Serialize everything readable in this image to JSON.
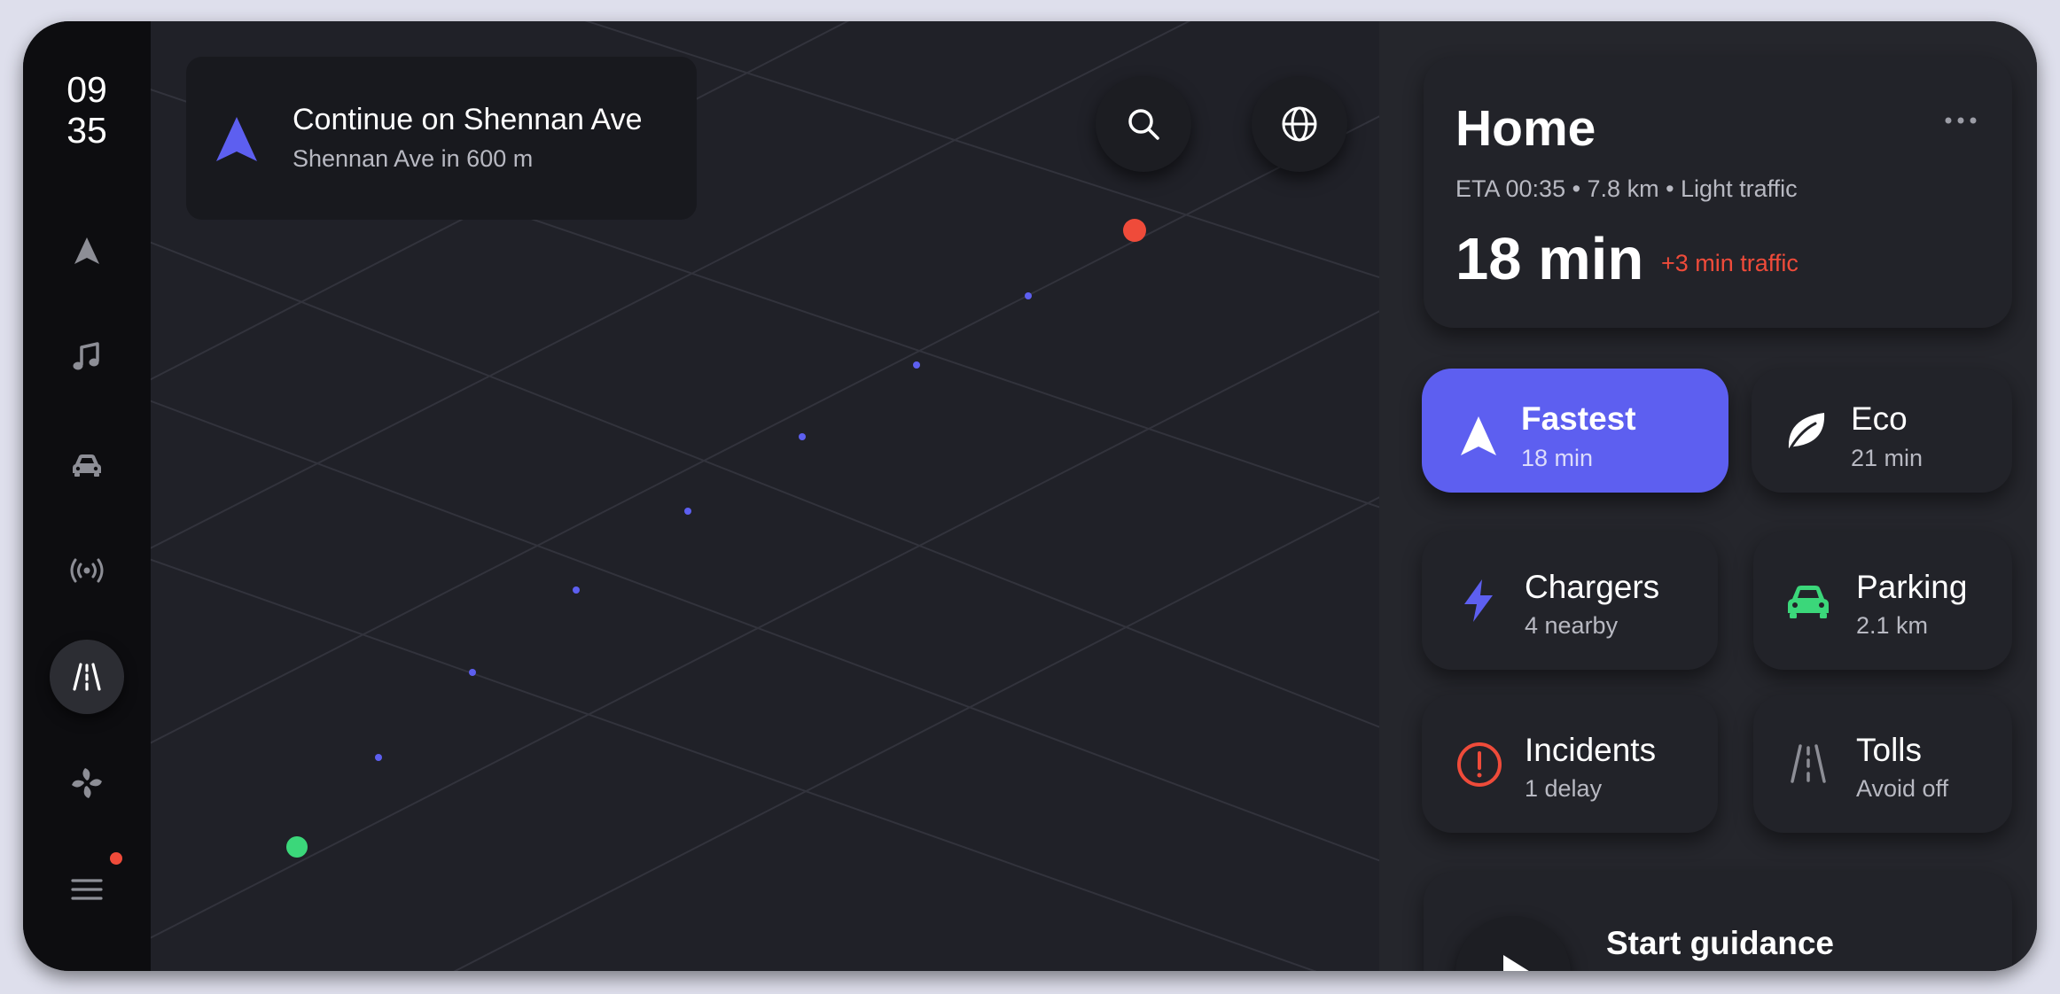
{
  "clock": {
    "hour": "09",
    "minute": "35"
  },
  "rail": {
    "items": [
      {
        "name": "navigation",
        "icon": "navigation-arrow-icon"
      },
      {
        "name": "music",
        "icon": "music-note-icon"
      },
      {
        "name": "vehicle",
        "icon": "car-icon"
      },
      {
        "name": "radio",
        "icon": "radio-waves-icon"
      },
      {
        "name": "road",
        "icon": "road-icon",
        "active": true
      },
      {
        "name": "climate",
        "icon": "fan-icon"
      },
      {
        "name": "menu",
        "icon": "menu-icon",
        "badge": true
      }
    ]
  },
  "map": {
    "turn": {
      "instruction": "Continue on Shennan Ave",
      "detail": "Shennan Ave in 600 m",
      "icon": "navigation-arrow-icon"
    },
    "search_icon": "search-icon",
    "layers_icon": "globe-icon",
    "route_color": "#5d5ff0",
    "origin_color": "#3bd77a",
    "destination_color": "#ef4b3a"
  },
  "destination": {
    "title": "Home",
    "meta": "ETA 00:35 • 7.8 km • Light traffic",
    "duration": "18 min",
    "traffic_delay": "+3 min traffic",
    "menu_icon": "more-horizontal-icon"
  },
  "routes": [
    {
      "label": "Fastest",
      "value": "18 min",
      "icon": "navigation-arrow-icon",
      "selected": true
    },
    {
      "label": "Eco",
      "value": "21 min",
      "icon": "leaf-icon",
      "selected": false
    }
  ],
  "tiles": [
    {
      "label": "Chargers",
      "value": "4 nearby",
      "icon": "lightning-icon",
      "color": "#5d5ff0"
    },
    {
      "label": "Parking",
      "value": "2.1 km",
      "icon": "car-icon",
      "color": "#3bd77a"
    },
    {
      "label": "Incidents",
      "value": "1 delay",
      "icon": "alert-circle-icon",
      "color": "#ef4b3a"
    },
    {
      "label": "Tolls",
      "value": "Avoid off",
      "icon": "road-icon",
      "color": "#8d8e96"
    }
  ],
  "start": {
    "label": "Start guidance",
    "icon": "play-icon"
  },
  "colors": {
    "accent": "#5d5ff0",
    "panel": "#25262c",
    "rail": "#0d0d10",
    "alert": "#ef4b3a",
    "success": "#3bd77a"
  }
}
